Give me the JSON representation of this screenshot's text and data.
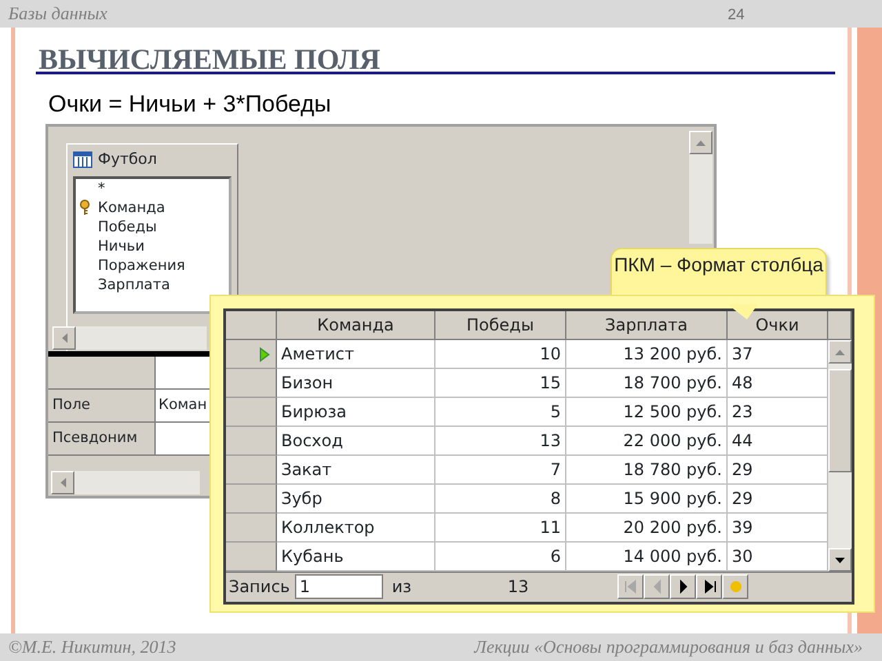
{
  "header": {
    "section": "Базы данных",
    "page_number": "24"
  },
  "title": "ВЫЧИСЛЯЕМЫЕ ПОЛЯ",
  "formula": "Очки = Ничьи + 3*Победы",
  "query_designer": {
    "table": {
      "name": "Футбол",
      "fields": [
        {
          "name": "*",
          "key": false
        },
        {
          "name": "Команда",
          "key": true
        },
        {
          "name": "Победы",
          "key": false
        },
        {
          "name": "Ничьи",
          "key": false
        },
        {
          "name": "Поражения",
          "key": false
        },
        {
          "name": "Зарплата",
          "key": false
        }
      ]
    },
    "grid_rows": [
      {
        "label": "Поле",
        "value": "Коман"
      },
      {
        "label": "Псевдоним"
      }
    ]
  },
  "callout": "ПКМ – Формат столбца",
  "datasheet": {
    "columns": [
      "Команда",
      "Победы",
      "Зарплата",
      "Очки"
    ],
    "rows": [
      {
        "current": true,
        "cells": [
          "Аметист",
          "10",
          "13 200 руб.",
          "37"
        ]
      },
      {
        "current": false,
        "cells": [
          "Бизон",
          "15",
          "18 700 руб.",
          "48"
        ]
      },
      {
        "current": false,
        "cells": [
          "Бирюза",
          "5",
          "12 500 руб.",
          "23"
        ]
      },
      {
        "current": false,
        "cells": [
          "Восход",
          "13",
          "22 000 руб.",
          "44"
        ]
      },
      {
        "current": false,
        "cells": [
          "Закат",
          "7",
          "18 780 руб.",
          "29"
        ]
      },
      {
        "current": false,
        "cells": [
          "Зубр",
          "8",
          "15 900 руб.",
          "29"
        ]
      },
      {
        "current": false,
        "cells": [
          "Коллектор",
          "11",
          "20 200 руб.",
          "39"
        ]
      },
      {
        "current": false,
        "cells": [
          "Кубань",
          "6",
          "14 000 руб.",
          "30"
        ]
      }
    ],
    "navigator": {
      "label": "Запись",
      "record": "1",
      "of": "из",
      "total": "13",
      "buttons": [
        {
          "kind": "first",
          "disabled": true
        },
        {
          "kind": "prev",
          "disabled": true
        },
        {
          "kind": "next",
          "disabled": false
        },
        {
          "kind": "last",
          "disabled": false
        },
        {
          "kind": "new",
          "disabled": false
        }
      ]
    }
  },
  "footer": {
    "author": "©М.Е. Никитин, 2013",
    "course": "Лекции «Основы программирования и баз данных»"
  }
}
